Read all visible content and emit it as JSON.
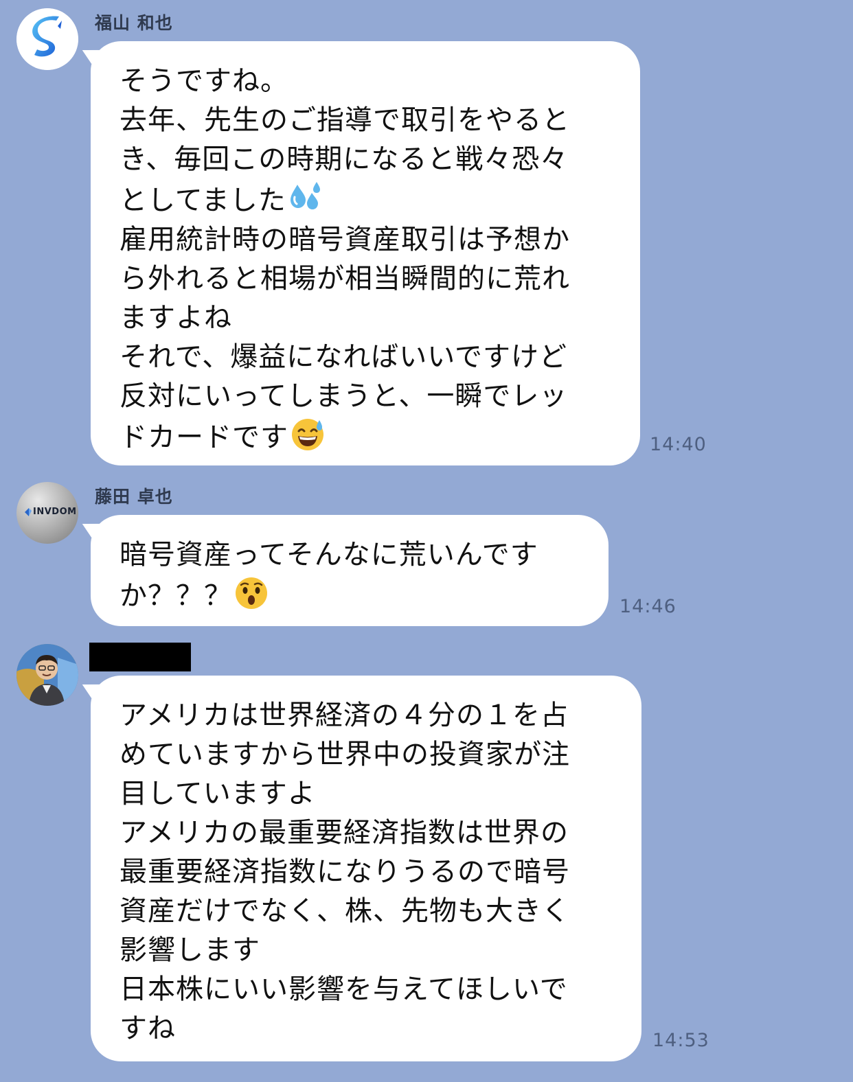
{
  "messages": [
    {
      "sender": "福山 和也",
      "avatar_icon": "blue-s-logo-icon",
      "lines": [
        "そうですね。",
        "去年、先生のご指導で取引をやると",
        "き、毎回この時期になると戦々恐々",
        "としてました",
        "雇用統計時の暗号資産取引は予想か",
        "ら外れると相場が相当瞬間的に荒れ",
        "ますよね",
        "それで、爆益になればいいですけど",
        "反対にいってしまうと、一瞬でレッ",
        "ドカードです"
      ],
      "emojis": [
        "sweat-droplets-icon",
        "grinning-sweat-face-icon"
      ],
      "time": "14:40"
    },
    {
      "sender": "藤田 卓也",
      "avatar_text": "INVDOM",
      "avatar_icon": "invdom-logo-icon",
      "lines": [
        "暗号資産ってそんなに荒いんです",
        "か？？？"
      ],
      "emojis": [
        "hushed-face-icon"
      ],
      "time": "14:46"
    },
    {
      "sender": "",
      "sender_redacted": true,
      "avatar_icon": "person-photo-icon",
      "lines": [
        "アメリカは世界経済の４分の１を占",
        "めていますから世界中の投資家が注",
        "目していますよ",
        "アメリカの最重要経済指数は世界の",
        "最重要経済指数になりうるので暗号",
        "資産だけでなく、株、先物も大きく",
        "影響します",
        "日本株にいい影響を与えてほしいで",
        "すね"
      ],
      "time": "14:53"
    }
  ],
  "colors": {
    "background": "#93a9d4",
    "bubble": "#ffffff",
    "time_text": "#4e5f80"
  }
}
